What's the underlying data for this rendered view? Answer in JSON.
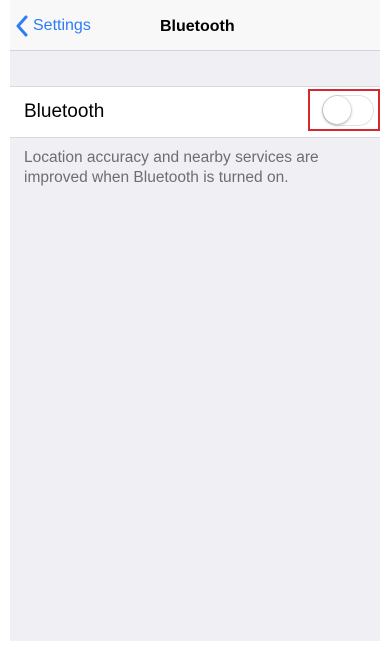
{
  "navbar": {
    "back_label": "Settings",
    "title": "Bluetooth",
    "accent_color": "#2e7cf6"
  },
  "bluetooth_cell": {
    "label": "Bluetooth",
    "toggle_state": "off"
  },
  "footer": {
    "text": "Location accuracy and nearby services are improved when Bluetooth is turned on."
  },
  "highlight_color": "#d7282f"
}
